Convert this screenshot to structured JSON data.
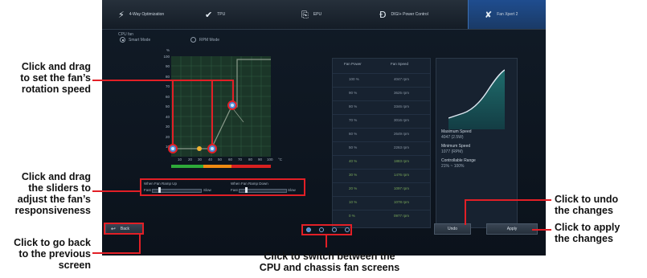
{
  "topbar": {
    "tabs": [
      {
        "icon": "turbo-icon",
        "glyph": "⚡",
        "label": "4-Way Optimization"
      },
      {
        "icon": "check-icon",
        "glyph": "✔",
        "label": "TPU"
      },
      {
        "icon": "chip-icon",
        "glyph": "⎘",
        "label": "EPU"
      },
      {
        "icon": "digi-icon",
        "glyph": "Ð",
        "label": "DIGI+ Power Control"
      },
      {
        "icon": "fan-icon",
        "glyph": "✘",
        "label": "Fan Xpert 2"
      }
    ]
  },
  "fan_section": {
    "label": "CPU fan",
    "modes": [
      "Smart Mode",
      "RPM Mode"
    ],
    "selected_mode": "Smart Mode",
    "y_axis_unit": "%",
    "y_ticks": [
      "100",
      "90",
      "80",
      "70",
      "60",
      "50",
      "40",
      "30",
      "20",
      "10"
    ],
    "x_ticks": [
      "10",
      "20",
      "30",
      "40",
      "50",
      "60",
      "70",
      "80",
      "90",
      "100"
    ],
    "x_axis_unit": "°C"
  },
  "sliders": [
    {
      "title": "When Fan Ramp Up",
      "min_label": "Fast",
      "max_label": "Slow"
    },
    {
      "title": "When Fan Ramp Down",
      "min_label": "Fast",
      "max_label": "Slow"
    }
  ],
  "table": {
    "headers": [
      "Fan Power",
      "Fan Speed"
    ],
    "rows": [
      [
        "100 %",
        "4047 rpm"
      ],
      [
        "90 %",
        "3625 rpm"
      ],
      [
        "80 %",
        "3346 rpm"
      ],
      [
        "70 %",
        "3016 rpm"
      ],
      [
        "60 %",
        "2649 rpm"
      ],
      [
        "50 %",
        "2263 rpm"
      ],
      [
        "40 %",
        "1883 rpm"
      ],
      [
        "30 %",
        "1476 rpm"
      ],
      [
        "20 %",
        "1097 rpm"
      ],
      [
        "10 %",
        "1078 rpm"
      ],
      [
        "0 %",
        "0977 rpm"
      ]
    ]
  },
  "info": {
    "max_label": "Maximum Speed",
    "max_value": "4047 (2.5W)",
    "min_label": "Minimum Speed",
    "min_value": "1077 (RPM)",
    "range_label": "Controllable Range",
    "range_value": "21% ~ 100%"
  },
  "buttons": {
    "back": "Back",
    "undo": "Undo",
    "apply": "Apply"
  },
  "annotations": {
    "drag_speed": "Click and drag\nto set the fan’s\nrotation speed",
    "drag_sliders": "Click and drag\nthe sliders to\nadjust the fan’s\nresponsiveness",
    "go_back": "Click to go back\nto the previous\nscreen",
    "switch_screens": "Click to switch between the\nCPU and chassis fan screens",
    "undo": "Click to undo\nthe changes",
    "apply": "Click to apply\nthe changes"
  },
  "colors": {
    "accent_red": "#e21f26",
    "active_tab": "#1f4d8f",
    "curve": "#7c8a6a",
    "band_green": "#2eaa3a",
    "band_orange": "#f08a12",
    "band_red": "#d82020"
  }
}
